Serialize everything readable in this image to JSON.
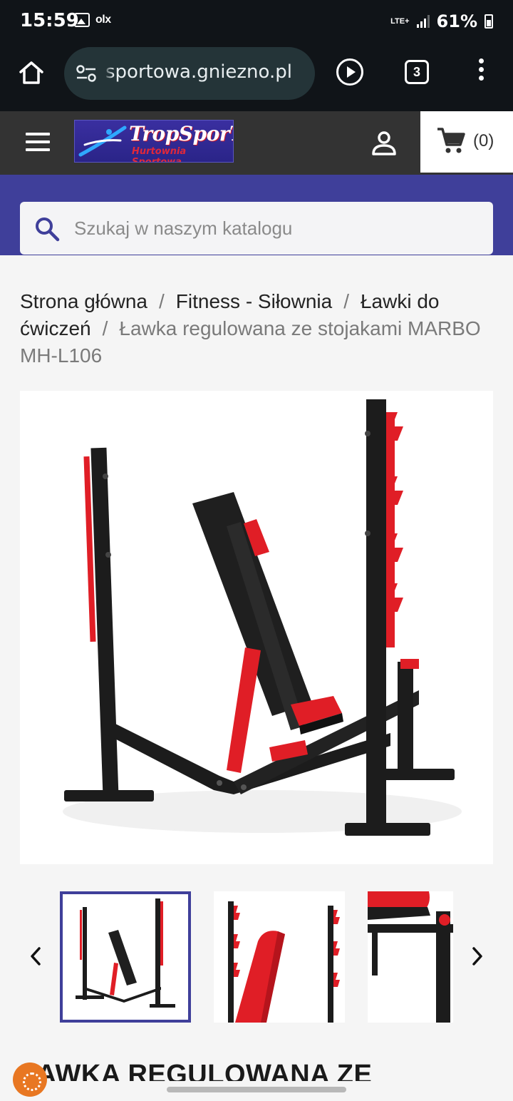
{
  "status_bar": {
    "time": "15:59",
    "notification_icons": [
      "image-icon",
      "olx-icon"
    ],
    "olx_text": "olx",
    "network": "LTE+",
    "battery": "61%"
  },
  "browser": {
    "url": "sportowa.gniezno.pl",
    "tab_count": "3"
  },
  "header": {
    "logo_main": "TropSporT",
    "logo_sub": "Hurtownia Sportowa",
    "cart_count": "(0)"
  },
  "search": {
    "placeholder": "Szukaj w naszym katalogu"
  },
  "breadcrumb": {
    "items": [
      "Strona główna",
      "Fitness - Siłownia",
      "Ławki do ćwiczeń"
    ],
    "current": "Ławka regulowana ze stojakami MARBO MH-L106"
  },
  "product": {
    "title_visible": "ŁAWKA REGULOWANA ZE",
    "thumbnails": [
      "thumbnail-1",
      "thumbnail-2",
      "thumbnail-3"
    ],
    "active_thumbnail": 0
  },
  "colors": {
    "header_bg": "#333333",
    "brand_band": "#3f3f9a",
    "accent_red": "#e01e26",
    "frame_black": "#1c1c1c"
  }
}
